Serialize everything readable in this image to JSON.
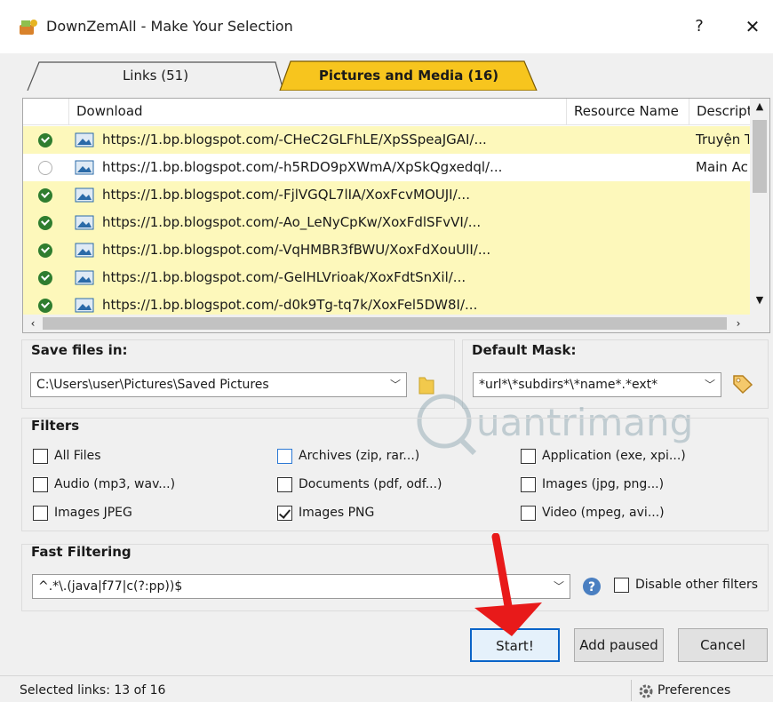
{
  "window": {
    "title": "DownZemAll - Make Your Selection",
    "help_label": "?",
    "close_label": "✕"
  },
  "tabs": [
    {
      "label": "Links (51)",
      "active": false
    },
    {
      "label": "Pictures and Media (16)",
      "active": true
    }
  ],
  "list": {
    "columns": [
      "Download",
      "Resource Name",
      "Descript"
    ],
    "rows": [
      {
        "url": "https://1.bp.blogspot.com/-CHeC2GLFhLE/XpSSpeaJGAI/...",
        "desc": "Truyện T",
        "checked": true
      },
      {
        "url": "https://1.bp.blogspot.com/-h5RDO9pXWmA/XpSkQgxedql/...",
        "desc": "Main Ac",
        "checked": false
      },
      {
        "url": "https://1.bp.blogspot.com/-FjlVGQL7lIA/XoxFcvMOUJI/...",
        "desc": "",
        "checked": true
      },
      {
        "url": "https://1.bp.blogspot.com/-Ao_LeNyCpKw/XoxFdlSFvVI/...",
        "desc": "",
        "checked": true
      },
      {
        "url": "https://1.bp.blogspot.com/-VqHMBR3fBWU/XoxFdXouUlI/...",
        "desc": "",
        "checked": true
      },
      {
        "url": "https://1.bp.blogspot.com/-GelHLVrioak/XoxFdtSnXil/...",
        "desc": "",
        "checked": true
      },
      {
        "url": "https://1.bp.blogspot.com/-d0k9Tg-tq7k/XoxFel5DW8I/...",
        "desc": "",
        "checked": true
      }
    ]
  },
  "save": {
    "title": "Save files in:",
    "path": "C:\\Users\\user\\Pictures\\Saved Pictures"
  },
  "mask": {
    "title": "Default Mask:",
    "value": "*url*\\*subdirs*\\*name*.*ext*"
  },
  "filters": {
    "title": "Filters",
    "items": [
      {
        "label": "All Files",
        "checked": false
      },
      {
        "label": "Archives (zip, rar...)",
        "checked": false
      },
      {
        "label": "Application (exe, xpi...)",
        "checked": false
      },
      {
        "label": "Audio (mp3, wav...)",
        "checked": false
      },
      {
        "label": "Documents (pdf, odf...)",
        "checked": false
      },
      {
        "label": "Images (jpg, png...)",
        "checked": false
      },
      {
        "label": "Images JPEG",
        "checked": false
      },
      {
        "label": "Images PNG",
        "checked": true
      },
      {
        "label": "Video (mpeg, avi...)",
        "checked": false
      }
    ]
  },
  "fast_filtering": {
    "title": "Fast Filtering",
    "value": "^.*\\.(java|f77|c(?:pp))$",
    "disable_label": "Disable other filters"
  },
  "buttons": {
    "start": "Start!",
    "add_paused": "Add paused",
    "cancel": "Cancel"
  },
  "status": {
    "text": "Selected links: 13 of 16",
    "preferences": "Preferences"
  },
  "colors": {
    "active_tab": "#f7c51e",
    "selected_row": "#fdf8bb",
    "check_green": "#2f7d2f",
    "arrow_red": "#e81a1a"
  }
}
